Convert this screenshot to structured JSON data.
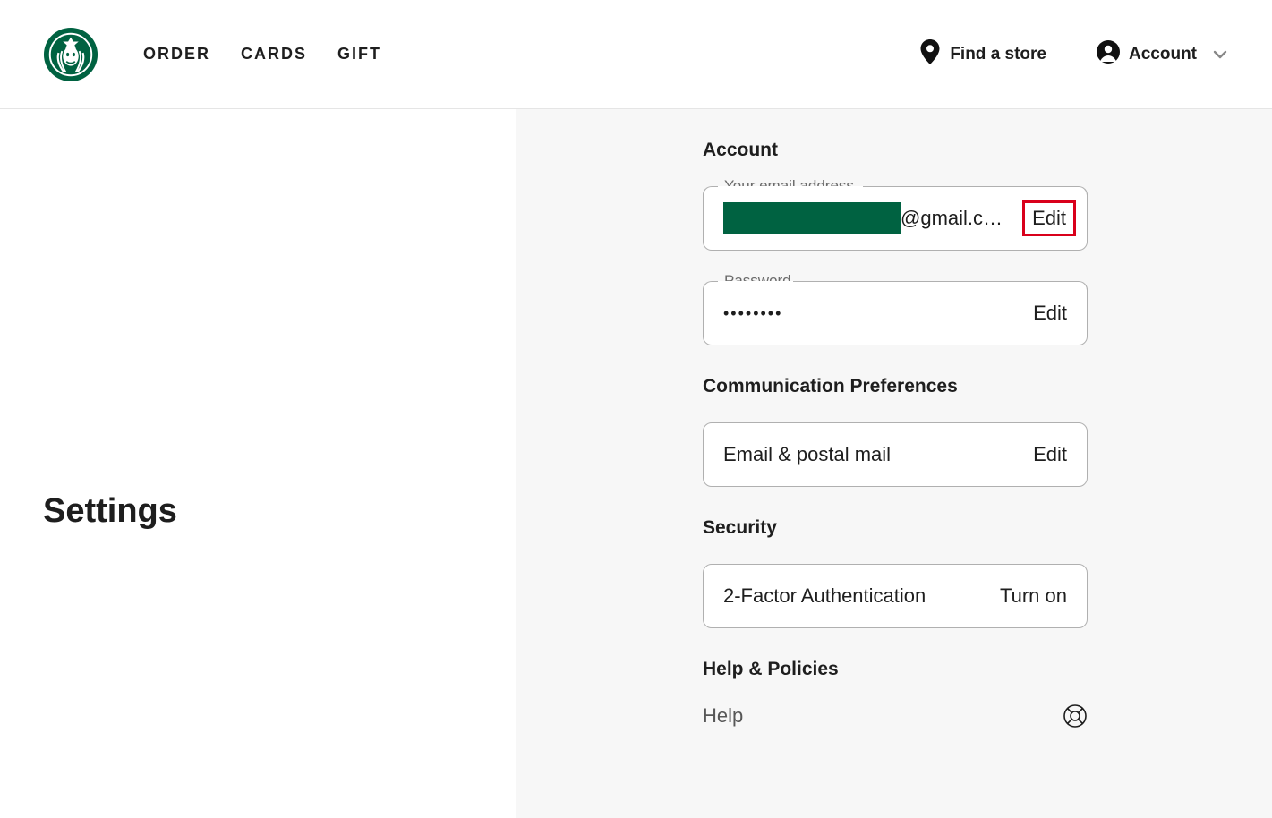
{
  "nav": {
    "order": "ORDER",
    "cards": "CARDS",
    "gift": "GIFT"
  },
  "header": {
    "find_store": "Find a store",
    "account": "Account"
  },
  "sidebar": {
    "title": "Settings"
  },
  "sections": {
    "account_title": "Account",
    "comm_title": "Communication Preferences",
    "security_title": "Security",
    "help_title": "Help & Policies"
  },
  "email": {
    "legend": "Your email address",
    "suffix": "@gmail.c…",
    "action": "Edit"
  },
  "password": {
    "legend": "Password",
    "mask": "••••••••",
    "action": "Edit"
  },
  "comm": {
    "label": "Email & postal mail",
    "action": "Edit"
  },
  "security": {
    "label": "2-Factor Authentication",
    "action": "Turn on"
  },
  "help": {
    "label": "Help"
  }
}
